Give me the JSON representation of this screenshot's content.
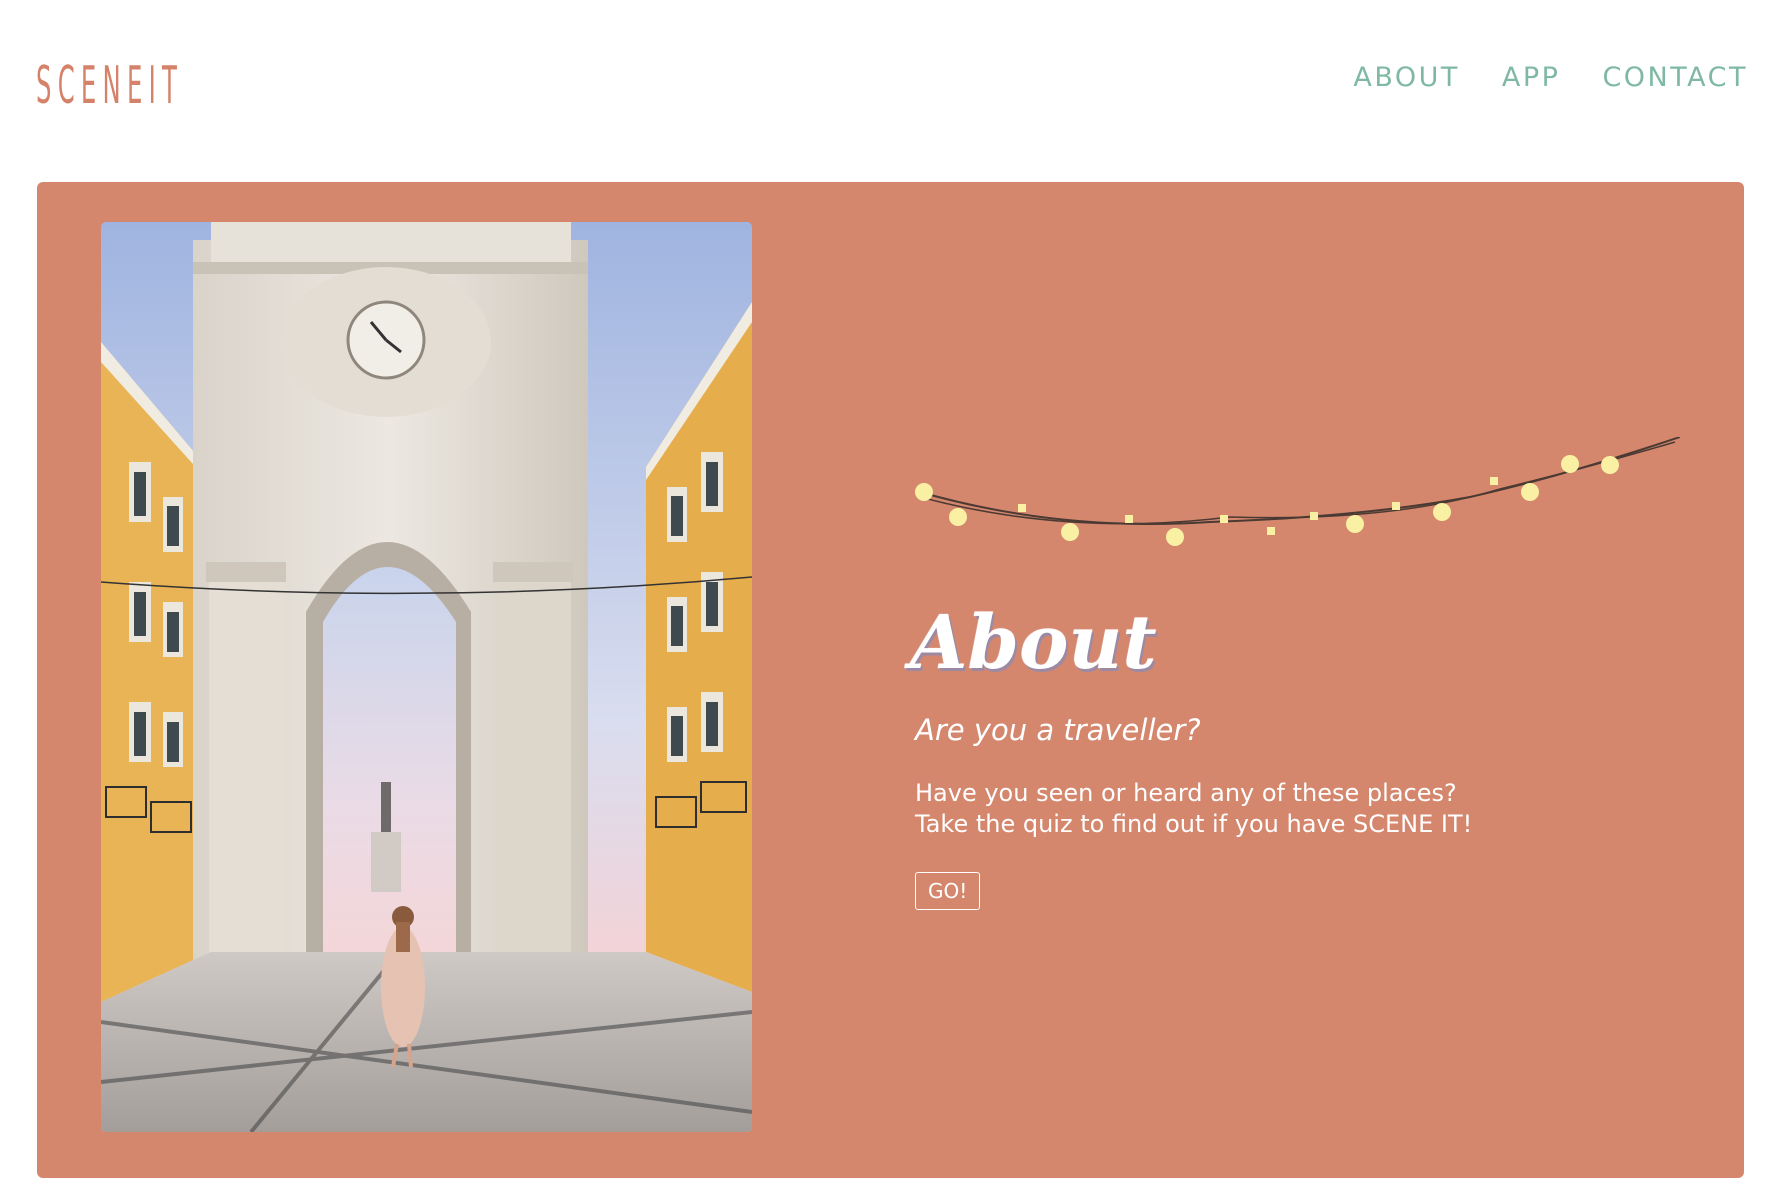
{
  "brand": {
    "logo_text": "SCENEIT",
    "color": "#d4826a"
  },
  "nav": {
    "items": [
      {
        "label": "ABOUT"
      },
      {
        "label": "APP"
      },
      {
        "label": "CONTACT"
      }
    ],
    "color": "#7fb9a3"
  },
  "hero": {
    "background": "#d4876d",
    "image_icon": "arch-photo",
    "decoration_icon": "string-lights-icon",
    "title": "About",
    "question": "Are you a traveller?",
    "description_lines": [
      "Have you seen or heard any of these places?",
      "Take the quiz to find out if you have SCENE IT!"
    ],
    "cta_label": "GO!"
  }
}
